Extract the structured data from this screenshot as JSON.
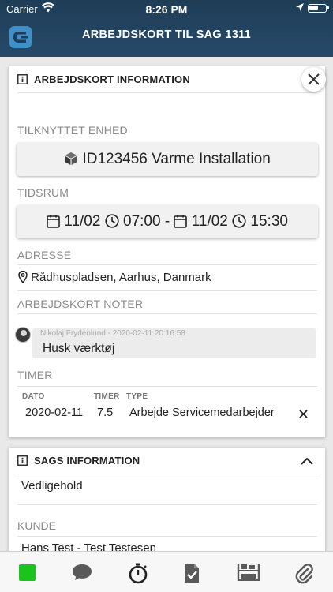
{
  "status_bar": {
    "carrier": "Carrier",
    "time": "8:26 PM"
  },
  "header": {
    "title": "ARBEJDSKORT TIL SAG 1311"
  },
  "work_card": {
    "heading": "ARBEJDSKORT INFORMATION",
    "unit_label": "TILKNYTTET ENHED",
    "unit_value": "ID123456 Varme Installation",
    "period_label": "TIDSRUM",
    "period": {
      "start_date": "11/02",
      "start_time": "07:00",
      "separator": "-",
      "end_date": "11/02",
      "end_time": "15:30"
    },
    "address_label": "ADRESSE",
    "address_value": "Rådhuspladsen, Aarhus, Danmark",
    "notes_label": "ARBEJDSKORT NOTER",
    "note": {
      "author": "Nikolaj Frydenlund - 2020-02-11 20:16:58",
      "text": "Husk værktøj"
    },
    "hours_label": "TIMER",
    "hours_table": {
      "columns": [
        "DATO",
        "TIMER",
        "TYPE"
      ],
      "rows": [
        {
          "date": "2020-02-11",
          "hours": "7.5",
          "type": "Arbejde Servicemedarbejder"
        }
      ]
    }
  },
  "case_card": {
    "heading": "SAGS INFORMATION",
    "description": "Vedligehold",
    "customer_label": "KUNDE",
    "customer_value": "Hans Test - Test Testesen"
  },
  "tab_bar": {
    "tabs": [
      "status",
      "chat",
      "timer",
      "checklist",
      "inventory",
      "attachments"
    ],
    "status_color": "#1bc41b"
  },
  "colors": {
    "header": "#264a69",
    "accent_green": "#1bc41b"
  }
}
